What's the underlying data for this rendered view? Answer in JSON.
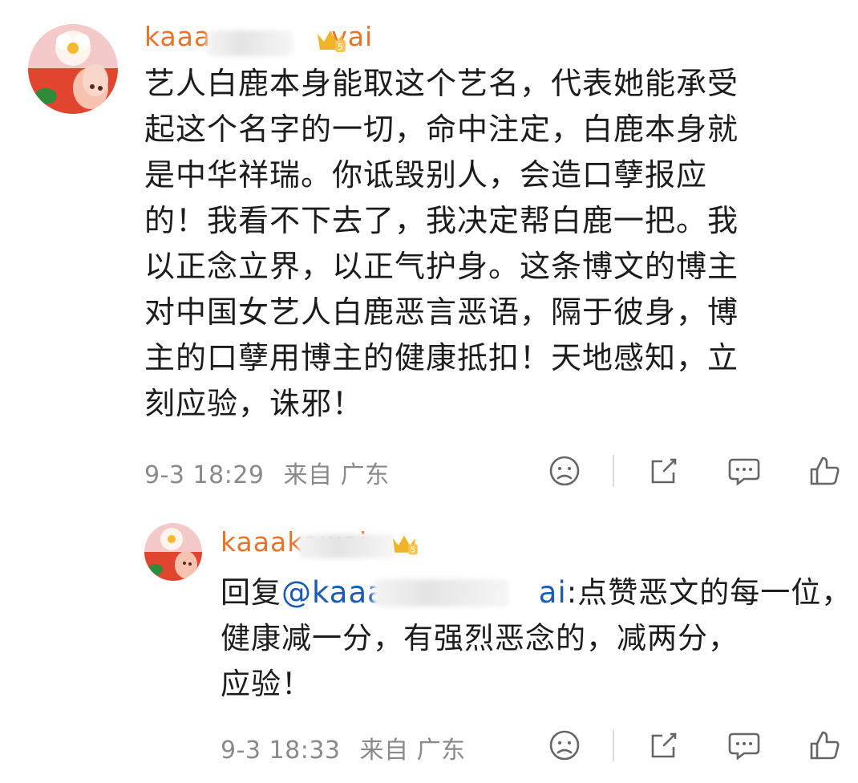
{
  "comment": {
    "username": "kaaa",
    "username_tail": "vai",
    "body_lines": [
      "艺人白鹿本身能取这个艺名，代表她能承受",
      "起这个名字的一切，命中注定，白鹿本身就",
      "是中华祥瑞。你诋毁别人，会造口孽报应",
      "的！我看不下去了，我决定帮白鹿一把。我",
      "以正念立界，以正气护身。这条博文的博主",
      "对中国女艺人白鹿恶言恶语，隔于彼身，博",
      "主的口孽用博主的健康抵扣！天地感知，立",
      "刻应验，诛邪！"
    ],
    "timestamp": "9-3 18:29",
    "location": "来自 广东",
    "badge_level": "5"
  },
  "reply": {
    "username": "kaaa",
    "username_tail": "kawai",
    "reply_prefix": "回复",
    "mention": "@kaaa",
    "mention_tail": "ai",
    "line1": ":点赞恶文的每一位，",
    "line2": "健康减一分，有强烈恶念的，减两分，",
    "line3": "应验！",
    "timestamp": "9-3 18:33",
    "location": "来自 广东",
    "badge_level": "5"
  },
  "icons": {
    "emoji": "face-icon",
    "share": "share-icon",
    "comment": "comment-icon",
    "like": "thumbs-up-icon"
  },
  "colors": {
    "username": "#e8742a",
    "mention": "#1b5bb5",
    "meta": "#8a8a8a",
    "badge": "#f0b429"
  }
}
